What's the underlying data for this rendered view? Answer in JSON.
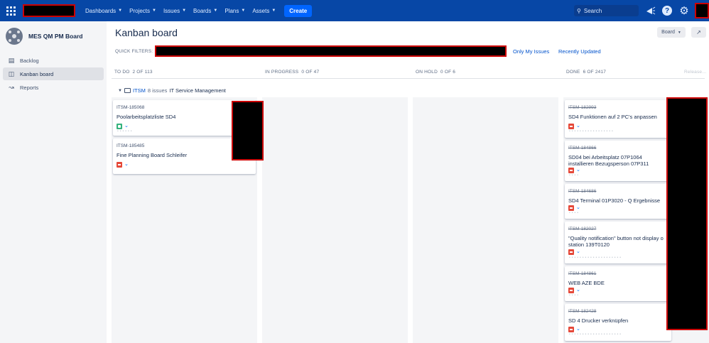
{
  "nav": {
    "links": [
      {
        "label": "Dashboards"
      },
      {
        "label": "Projects"
      },
      {
        "label": "Issues"
      },
      {
        "label": "Boards"
      },
      {
        "label": "Plans"
      },
      {
        "label": "Assets"
      }
    ],
    "create_label": "Create",
    "search_placeholder": "Search",
    "icons": [
      "apps-icon",
      "notifications-icon",
      "help-icon",
      "settings-icon"
    ]
  },
  "sidebar": {
    "project_name": "MES QM PM Board",
    "items": [
      {
        "label": "Backlog",
        "icon": "backlog-icon",
        "active": false
      },
      {
        "label": "Kanban board",
        "icon": "board-icon",
        "active": true
      },
      {
        "label": "Reports",
        "icon": "reports-icon",
        "active": false
      }
    ]
  },
  "main": {
    "title": "Kanban board",
    "board_button": "Board",
    "quick_filters_label": "QUICK FILTERS:",
    "quick_filter_links": [
      "Only My Issues",
      "Recently Updated"
    ]
  },
  "columns": [
    {
      "name": "TO DO",
      "count": "2 OF 113"
    },
    {
      "name": "IN PROGRESS",
      "count": "0 OF 47"
    },
    {
      "name": "ON HOLD",
      "count": "0 OF 6"
    },
    {
      "name": "DONE",
      "count": "6 OF 2417"
    }
  ],
  "release_label": "Release...",
  "swimlane": {
    "key": "ITSM",
    "count": "8 issues",
    "name": "IT Service Management"
  },
  "todo_cards": [
    {
      "key": "ITSM-185068",
      "summary": "Poolarbeitsplatzliste SD4",
      "type": "story"
    },
    {
      "key": "ITSM-185485",
      "summary": "Fine Planning Board Schleifer",
      "type": "bug"
    }
  ],
  "done_cards": [
    {
      "key": "ITSM-182993",
      "summary": "SD4 Funktionen auf 2 PC's anpassen"
    },
    {
      "key": "ITSM-184866",
      "summary": "SD04 bei Arbeitsplatz 07P1064 installieren Bezugsperson 07P311"
    },
    {
      "key": "ITSM-184686",
      "summary": "SD4 Terminal 01P3020 - Q Ergebnisse"
    },
    {
      "key": "ITSM-182027",
      "summary": "\"Quality notification\" button not display o station 139T0120"
    },
    {
      "key": "ITSM-184861",
      "summary": "WEB AZE BDE"
    },
    {
      "key": "ITSM-182428",
      "summary": "SD 4 Drucker verknüpfen"
    }
  ]
}
